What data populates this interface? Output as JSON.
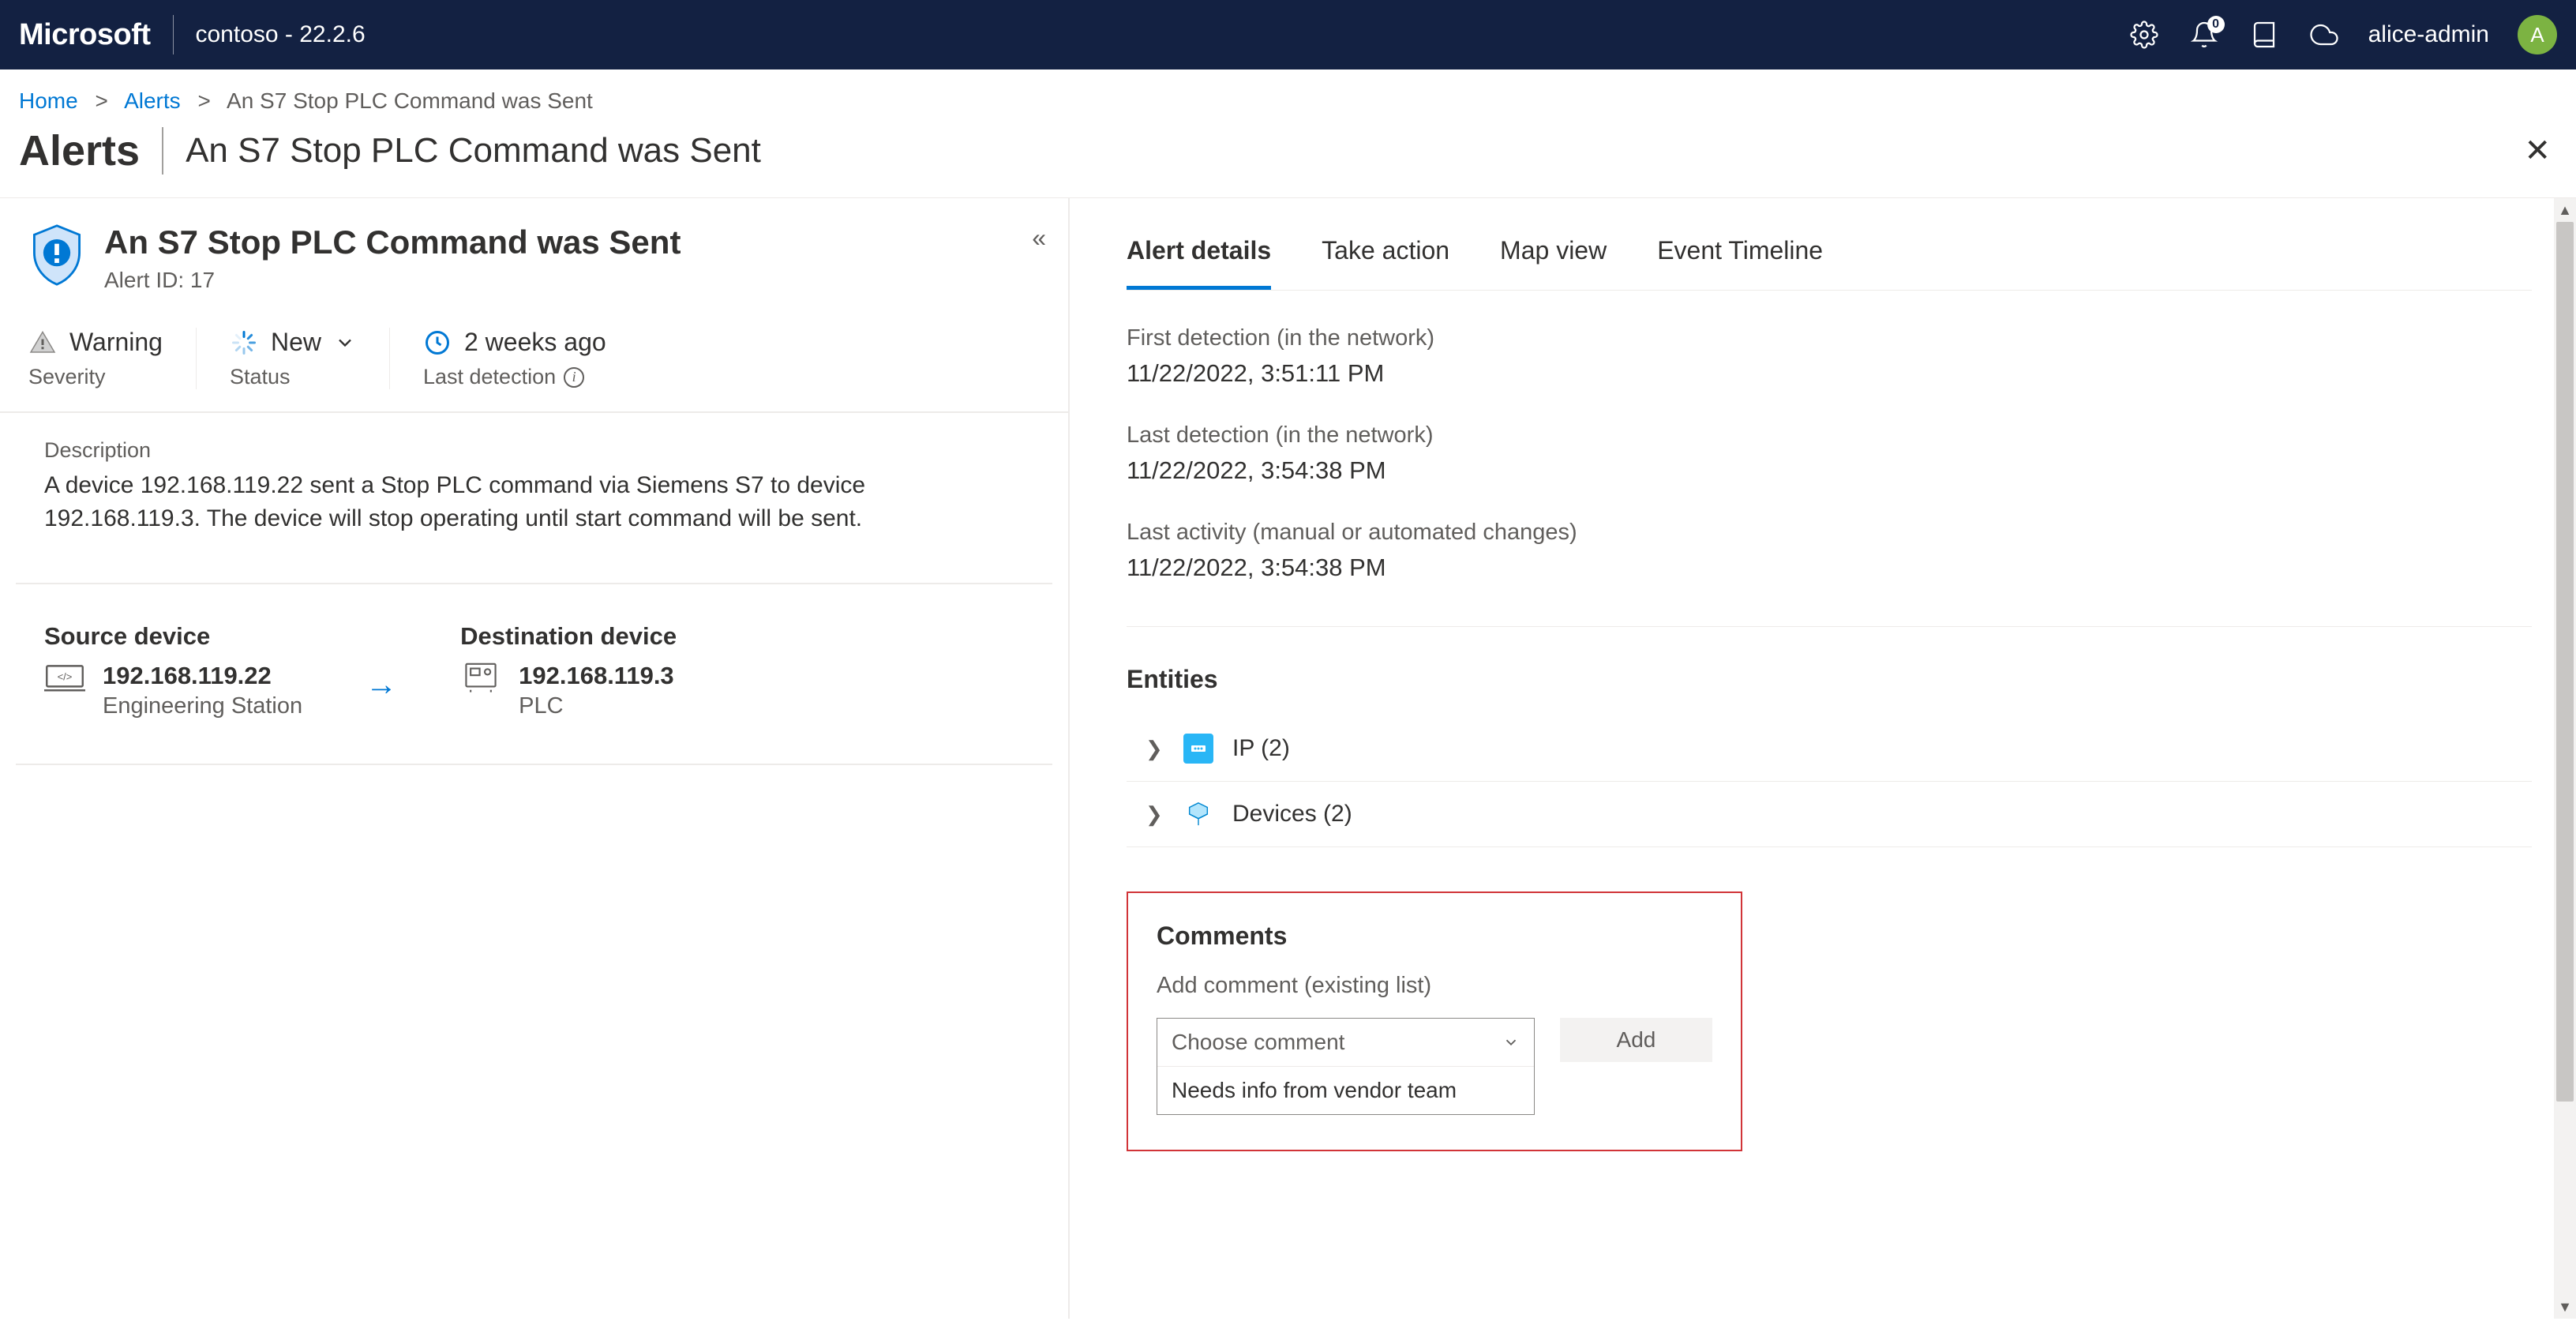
{
  "header": {
    "brand": "Microsoft",
    "tenant": "contoso - 22.2.6",
    "notification_count": "0",
    "user_name": "alice-admin",
    "user_initial": "A"
  },
  "breadcrumb": {
    "home": "Home",
    "alerts": "Alerts",
    "current": "An S7 Stop PLC Command was Sent"
  },
  "page": {
    "section": "Alerts",
    "title": "An S7 Stop PLC Command was Sent"
  },
  "alert": {
    "name": "An S7 Stop PLC Command was Sent",
    "id_label": "Alert ID: 17",
    "severity_value": "Warning",
    "severity_label": "Severity",
    "status_value": "New",
    "status_label": "Status",
    "last_detection_value": "2 weeks ago",
    "last_detection_label": "Last detection",
    "description_label": "Description",
    "description_text": "A device 192.168.119.22 sent a Stop PLC command via Siemens S7 to device 192.168.119.3. The device will stop operating until start command will be sent."
  },
  "source_device": {
    "heading": "Source device",
    "ip": "192.168.119.22",
    "type": "Engineering Station"
  },
  "destination_device": {
    "heading": "Destination device",
    "ip": "192.168.119.3",
    "type": "PLC"
  },
  "tabs": {
    "details": "Alert details",
    "take_action": "Take action",
    "map_view": "Map view",
    "timeline": "Event Timeline"
  },
  "details": {
    "first_detection_label": "First detection (in the network)",
    "first_detection_value": "11/22/2022, 3:51:11 PM",
    "last_detection_label": "Last detection (in the network)",
    "last_detection_value": "11/22/2022, 3:54:38 PM",
    "last_activity_label": "Last activity (manual or automated changes)",
    "last_activity_value": "11/22/2022, 3:54:38 PM"
  },
  "entities": {
    "heading": "Entities",
    "ip_label": "IP (2)",
    "devices_label": "Devices (2)"
  },
  "comments": {
    "heading": "Comments",
    "add_label": "Add comment (existing list)",
    "placeholder": "Choose comment",
    "option1": "Needs info from vendor team",
    "add_button": "Add"
  }
}
